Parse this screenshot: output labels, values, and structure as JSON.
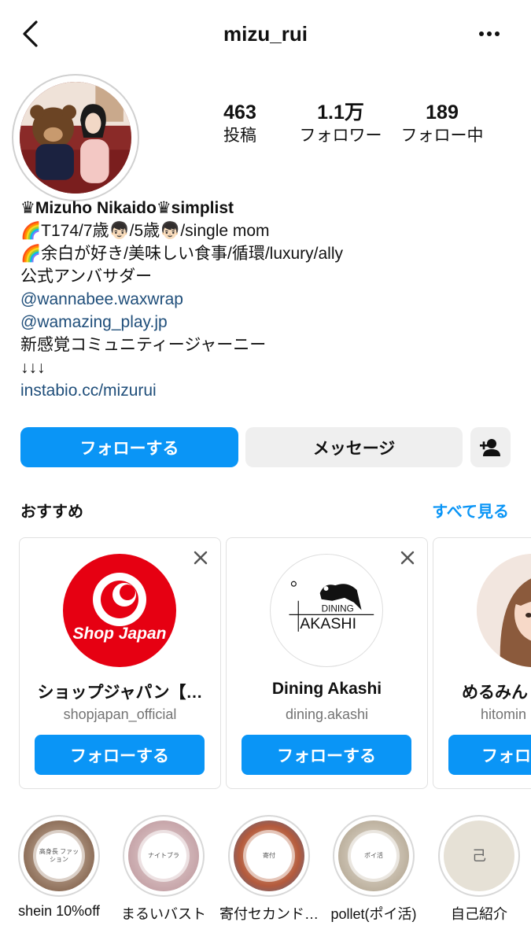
{
  "header": {
    "title": "mizu_rui"
  },
  "stats": [
    {
      "value": "463",
      "label": "投稿"
    },
    {
      "value": "1.1万",
      "label": "フォロワー"
    },
    {
      "value": "189",
      "label": "フォロー中"
    }
  ],
  "bio": {
    "name": "♛Mizuho Nikaido♛simplist",
    "line1": "🌈T174/7歳👦🏻/5歳👦🏻/single mom",
    "line2": "🌈余白が好き/美味しい食事/循環/luxury/ally",
    "line3": "公式アンバサダー",
    "mention1": "@wannabee.waxwrap",
    "mention2": "@wamazing_play.jp",
    "line4": "新感覚コミュニティージャーニー",
    "line5": "↓↓↓",
    "link": "instabio.cc/mizurui"
  },
  "actions": {
    "follow": "フォローする",
    "message": "メッセージ"
  },
  "suggested": {
    "heading": "おすすめ",
    "see_all": "すべて見る",
    "cards": [
      {
        "name": "ショップジャパン【…",
        "username": "shopjapan_official",
        "follow": "フォローする",
        "logo_text": "Shop Japan"
      },
      {
        "name": "Dining Akashi",
        "username": "dining.akashi",
        "follow": "フォローする",
        "logo_text_top": "DINING",
        "logo_text_bottom": "AKASHI"
      },
      {
        "name": "めるみん",
        "username": "hitomin",
        "follow": "フォロ"
      }
    ]
  },
  "highlights": [
    {
      "label": "shein 10%off",
      "badge": "高身長 ファッション"
    },
    {
      "label": "まるいバスト",
      "badge": "ナイトブラ"
    },
    {
      "label": "寄付セカンド…",
      "badge": "寄付"
    },
    {
      "label": "pollet(ポイ活)",
      "badge": "ポイ活"
    },
    {
      "label": "自己紹介",
      "badge": "己"
    }
  ],
  "colors": {
    "accent": "#0a95f6",
    "link": "#1f4e7a",
    "shopjapan_red": "#e60012"
  }
}
